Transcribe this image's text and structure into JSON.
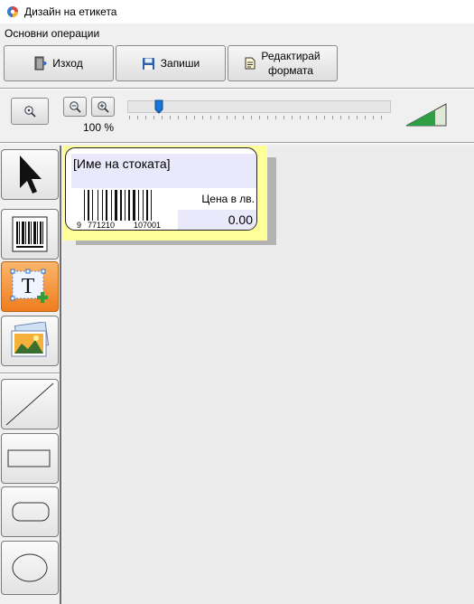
{
  "window": {
    "title": "Дизайн на етикета"
  },
  "menu": {
    "items": [
      "Основни операции"
    ]
  },
  "toolbar": {
    "exit_label": "Изход",
    "save_label": "Запиши",
    "edit_format_label": "Редактирай\nформата"
  },
  "zoom": {
    "level_label": "100 %",
    "slider_value": 0.12
  },
  "tools": [
    "pointer",
    "barcode",
    "text",
    "image",
    "line",
    "rectangle",
    "rounded-rectangle",
    "ellipse"
  ],
  "active_tool": "text",
  "label": {
    "name_field": "[Име на стоката]",
    "price_caption": "Цена в лв.",
    "price_value": "0.00",
    "barcode_digits": [
      "9",
      "771210",
      "107001"
    ]
  },
  "colors": {
    "label_background": "#ffff99",
    "field_highlight": "#e9e9fb",
    "active_tool": "#f07c1e",
    "slider_thumb": "#1a73d6",
    "level_indicator": "#2ea043"
  }
}
